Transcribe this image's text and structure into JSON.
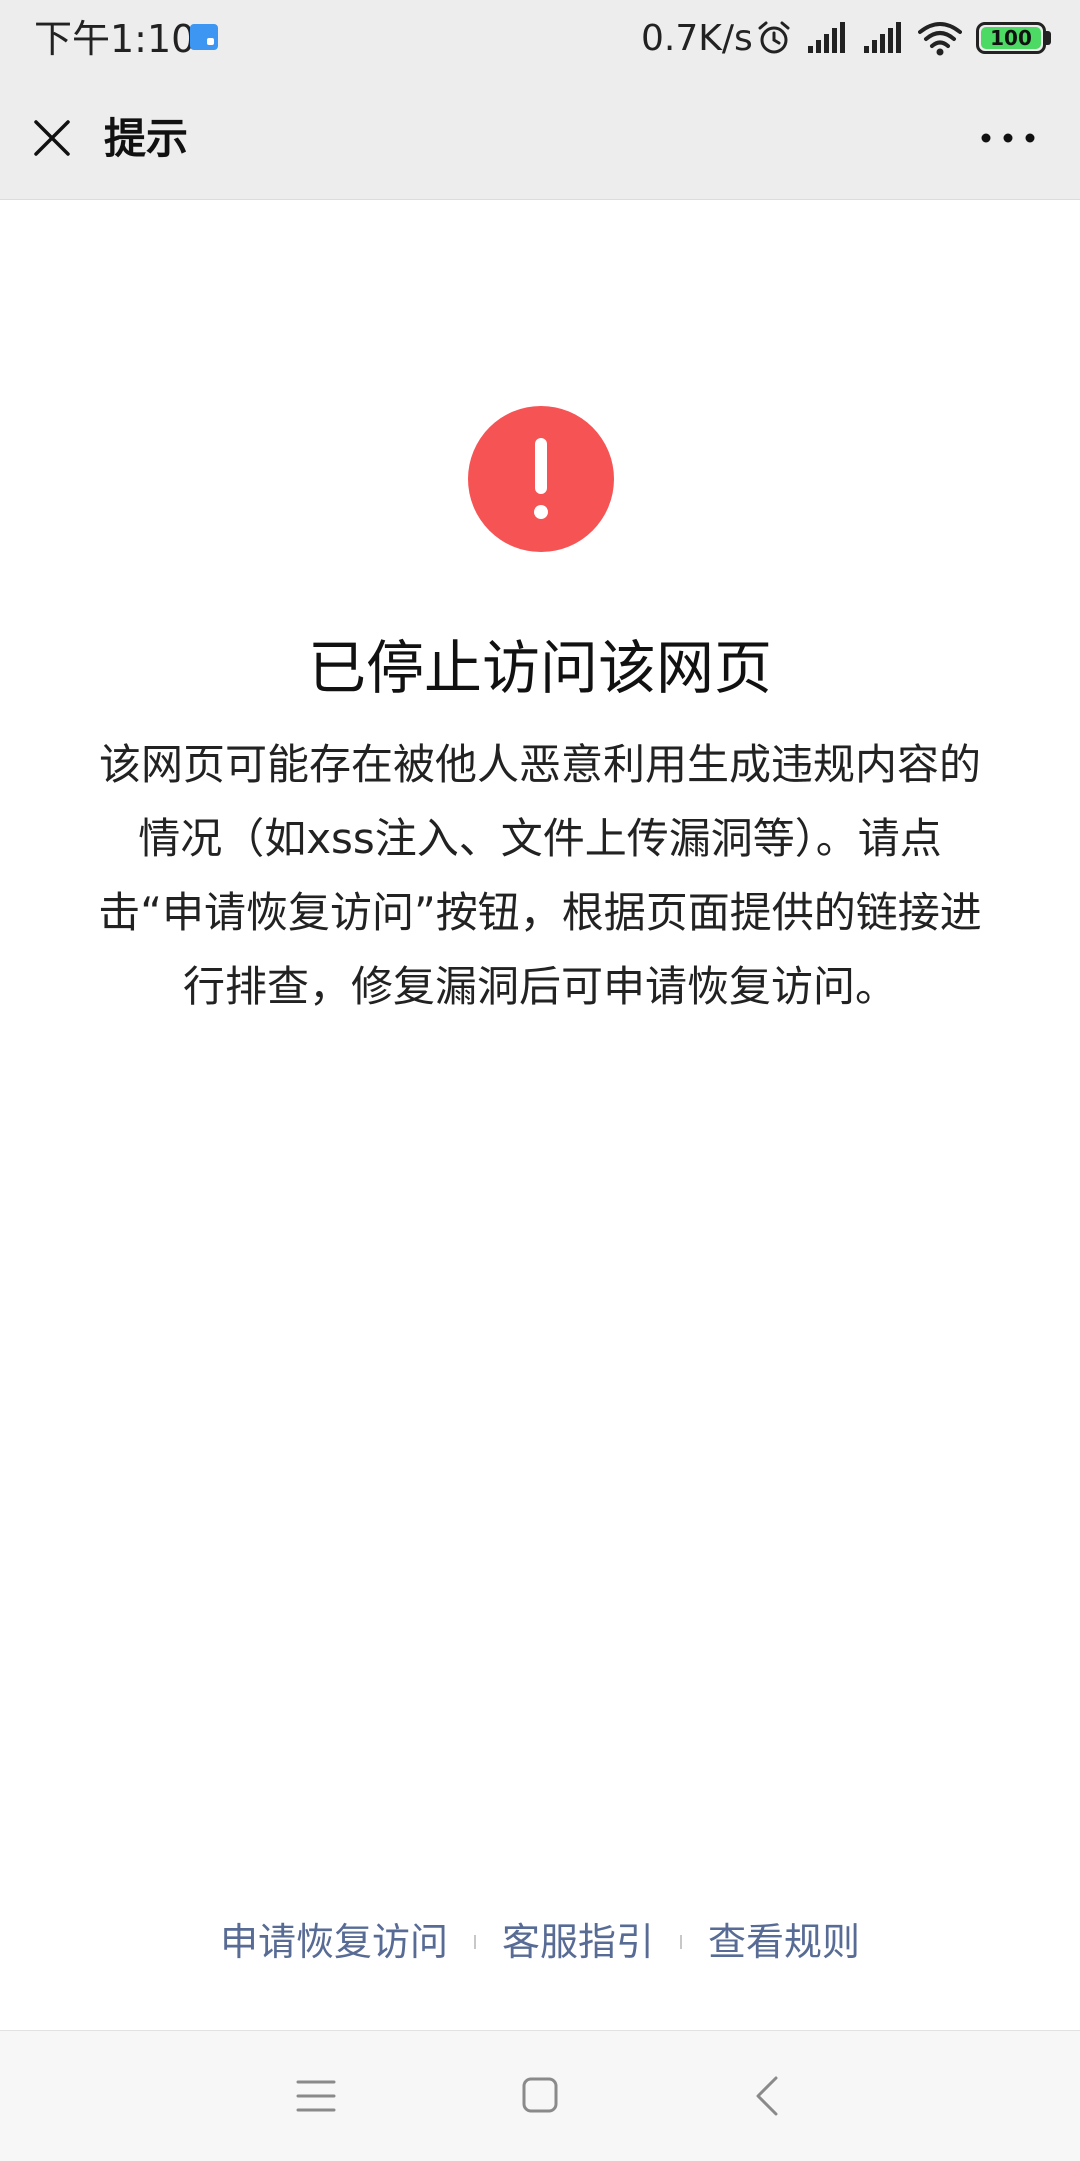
{
  "status_bar": {
    "time": "下午1:10",
    "network_speed": "0.7K/s",
    "battery": "100",
    "icons": [
      "notification-icon",
      "alarm-icon",
      "signal-icon",
      "signal-icon",
      "wifi-icon",
      "battery-icon"
    ]
  },
  "top_bar": {
    "title": "提示",
    "close_icon": "close-icon",
    "more_icon": "more-icon"
  },
  "main": {
    "icon": "warning-icon",
    "icon_color": "#f65354",
    "title": "已停止访问该网页",
    "description": "该网页可能存在被他人恶意利用生成违规内容的情况（如xss注入、文件上传漏洞等）。请点击“申请恢复访问”按钮，根据页面提供的链接进行排查，修复漏洞后可申请恢复访问。"
  },
  "footer": {
    "links": [
      {
        "label": "申请恢复访问"
      },
      {
        "label": "客服指引"
      },
      {
        "label": "查看规则"
      }
    ],
    "link_color": "#576b95"
  },
  "nav_bar": {
    "icons": [
      "menu-icon",
      "home-icon",
      "back-icon"
    ]
  }
}
